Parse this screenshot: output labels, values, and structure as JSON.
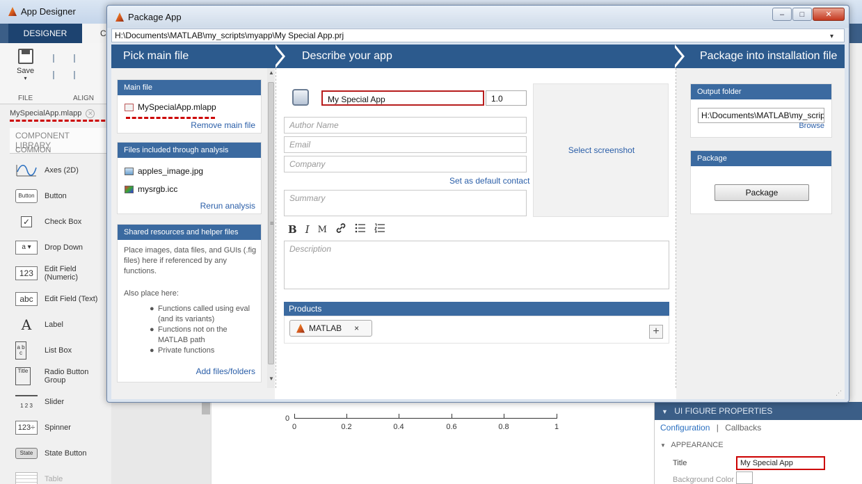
{
  "background_app": {
    "title": "App Designer",
    "tabs": [
      "DESIGNER",
      "C"
    ],
    "ribbon": {
      "save_label": "Save",
      "file_label": "FILE",
      "align_label": "ALIGN"
    },
    "file_tab": "MySpecialApp.mlapp",
    "component_library": "COMPONENT LIBRARY",
    "common": "COMMON",
    "components": [
      {
        "icon": "axes-icon",
        "label": "Axes (2D)"
      },
      {
        "icon": "button-icon",
        "icon_text": "Button",
        "label": "Button"
      },
      {
        "icon": "checkbox-icon",
        "icon_text": "✓",
        "label": "Check Box"
      },
      {
        "icon": "dropdown-icon",
        "icon_text": "a ▾",
        "label": "Drop Down"
      },
      {
        "icon": "numeric-field-icon",
        "icon_text": "123",
        "label": "Edit Field (Numeric)"
      },
      {
        "icon": "text-field-icon",
        "icon_text": "abc",
        "label": "Edit Field (Text)"
      },
      {
        "icon": "label-icon",
        "icon_text": "A",
        "label": "Label"
      },
      {
        "icon": "listbox-icon",
        "icon_text": "a b c",
        "label": "List Box"
      },
      {
        "icon": "radio-group-icon",
        "icon_text": "Title",
        "label": "Radio Button Group"
      },
      {
        "icon": "slider-icon",
        "icon_text": "1 2 3",
        "label": "Slider"
      },
      {
        "icon": "spinner-icon",
        "icon_text": "123÷",
        "label": "Spinner"
      },
      {
        "icon": "state-button-icon",
        "icon_text": "State",
        "label": "State Button"
      },
      {
        "icon": "table-icon",
        "icon_text": "",
        "label": "Table"
      }
    ],
    "axes": {
      "y_tick": "0",
      "x_ticks": [
        "0",
        "0.2",
        "0.4",
        "0.6",
        "0.8",
        "1"
      ]
    },
    "properties": {
      "header": "UI FIGURE PROPERTIES",
      "tab_configuration": "Configuration",
      "tab_separator": "|",
      "tab_callbacks": "Callbacks",
      "appearance": "APPEARANCE",
      "title_label": "Title",
      "title_value": "My Special App",
      "background_color_label": "Background Color"
    }
  },
  "dialog": {
    "title": "Package App",
    "window_buttons": {
      "minimize": "–",
      "maximize": "□",
      "close": "✕"
    },
    "project_path": "H:\\Documents\\MATLAB\\my_scripts\\myapp\\My Special App.prj",
    "steps": [
      "Pick main file",
      "Describe your app",
      "Package into installation file"
    ],
    "main_file": {
      "header": "Main file",
      "file": "MySpecialApp.mlapp",
      "remove_link": "Remove main file"
    },
    "analysis": {
      "header": "Files included through analysis",
      "files": [
        "apples_image.jpg",
        "mysrgb.icc"
      ],
      "rerun_link": "Rerun analysis"
    },
    "shared": {
      "header": "Shared resources and helper files",
      "description": "Place images, data files, and GUIs (.fig files) here if referenced by any functions.",
      "also_place": "Also place here:",
      "bullets": [
        "Functions called using eval (and its variants)",
        "Functions not on the MATLAB path",
        "Private functions"
      ],
      "add_link": "Add files/folders"
    },
    "describe": {
      "app_name": "My Special App",
      "version": "1.0",
      "author_placeholder": "Author Name",
      "email_placeholder": "Email",
      "company_placeholder": "Company",
      "set_default_link": "Set as default contact",
      "summary_placeholder": "Summary",
      "description_placeholder": "Description",
      "select_screenshot_link": "Select screenshot",
      "format_buttons": [
        "B",
        "I",
        "M",
        "🔗",
        "☰",
        "⋮☰"
      ],
      "products_header": "Products",
      "product_chip": "MATLAB",
      "product_remove": "×",
      "add_product": "+"
    },
    "package": {
      "output_header": "Output folder",
      "output_value": "H:\\Documents\\MATLAB\\my_scripts\\myapp",
      "browse_link": "Browse",
      "package_header": "Package",
      "package_button": "Package"
    }
  }
}
